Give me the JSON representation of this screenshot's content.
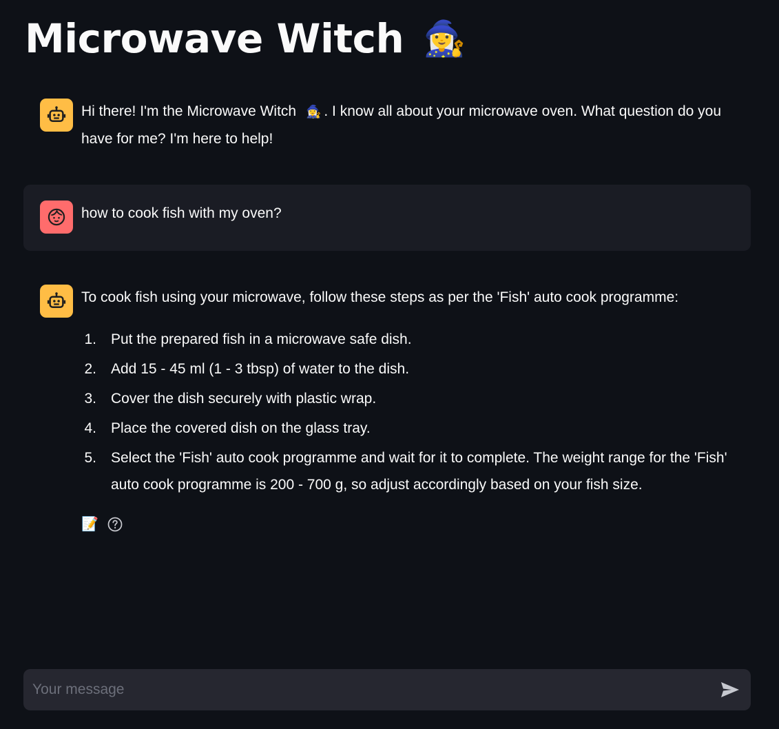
{
  "app": {
    "title": "Microwave Witch",
    "title_emoji": "🧙‍♀️"
  },
  "messages": {
    "greeting": {
      "role": "assistant",
      "text_before": "Hi there! I'm the Microwave Witch",
      "emoji": "🧙‍♀️",
      "text_after": ". I know all about your microwave oven. What question do you have for me? I'm here to help!"
    },
    "question": {
      "role": "user",
      "text": "how to cook fish with my oven?"
    },
    "answer": {
      "role": "assistant",
      "intro": "To cook fish using your microwave, follow these steps as per the 'Fish' auto cook programme:",
      "steps": [
        {
          "num": "1.",
          "text": "Put the prepared fish in a microwave safe dish."
        },
        {
          "num": "2.",
          "text": "Add 15 - 45 ml (1 - 3 tbsp) of water to the dish."
        },
        {
          "num": "3.",
          "text": "Cover the dish securely with plastic wrap."
        },
        {
          "num": "4.",
          "text": "Place the covered dish on the glass tray."
        },
        {
          "num": "5.",
          "text": "Select the 'Fish' auto cook programme and wait for it to complete. The weight range for the 'Fish' auto cook programme is 200 - 700 g, so adjust accordingly based on your fish size."
        }
      ],
      "actions": {
        "memo_icon": "📝",
        "help_icon": "question-circle-icon"
      }
    }
  },
  "input": {
    "placeholder": "Your message",
    "value": "",
    "send_icon": "paper-plane-icon"
  },
  "colors": {
    "background": "#0e1117",
    "user_bubble": "#1a1c24",
    "input_bg": "#262730",
    "bot_avatar": "#ffbd45",
    "user_avatar": "#ff6c6c"
  }
}
